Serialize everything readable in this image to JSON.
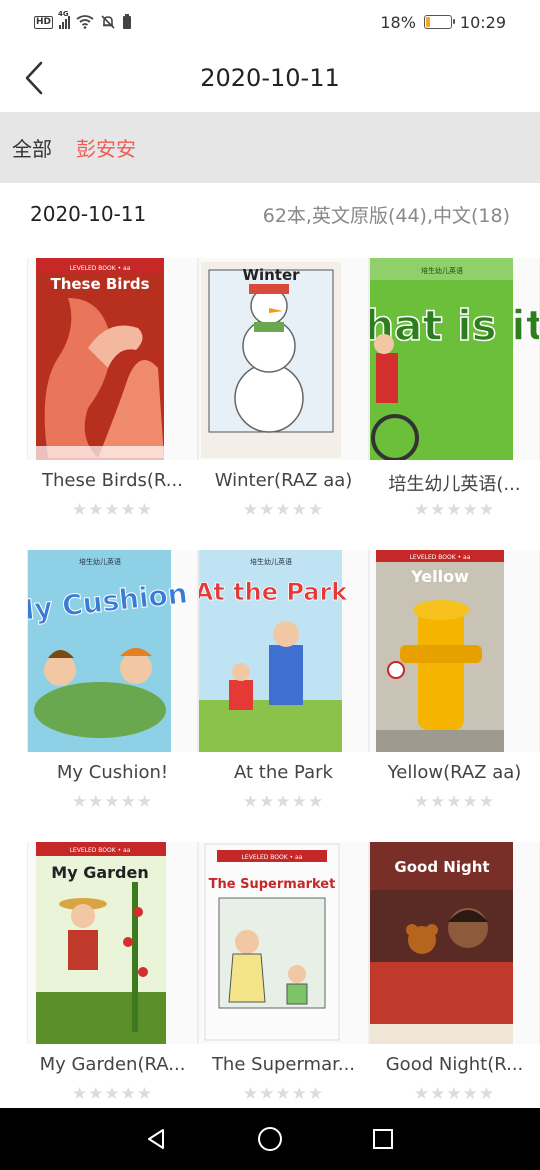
{
  "status_bar": {
    "hd_badge": "HD",
    "network": "4G",
    "battery_text": "18%",
    "battery_level": 0.18,
    "time": "10:29",
    "icons": [
      "signal-icon",
      "wifi-icon",
      "bell-muted-icon",
      "sim-icon",
      "battery-icon"
    ]
  },
  "header": {
    "title": "2020-10-11",
    "back_icon": "chevron-left-icon"
  },
  "filters": {
    "items": [
      {
        "label": "全部",
        "active": false
      },
      {
        "label": "彭安安",
        "active": true
      }
    ],
    "active_color": "#f25a52"
  },
  "summary": {
    "date": "2020-10-11",
    "stats": "62本,英文原版(44),中文(18)"
  },
  "books": [
    {
      "title": "These Birds(R...",
      "cover_label": "These Birds",
      "rating": 0
    },
    {
      "title": "Winter(RAZ aa)",
      "cover_label": "Winter",
      "rating": 0
    },
    {
      "title": "培生幼儿英语(...",
      "cover_label": "What is it?",
      "rating": 0
    },
    {
      "title": "My Cushion!",
      "cover_label": "My Cushion",
      "rating": 0
    },
    {
      "title": "At the Park",
      "cover_label": "At the Park",
      "rating": 0
    },
    {
      "title": "Yellow(RAZ aa)",
      "cover_label": "Yellow",
      "rating": 0
    },
    {
      "title": "My Garden(RA...",
      "cover_label": "My Garden",
      "rating": 0
    },
    {
      "title": "The Supermar...",
      "cover_label": "The Supermarket",
      "rating": 0
    },
    {
      "title": "Good Night(R...",
      "cover_label": "Good Night",
      "rating": 0
    }
  ],
  "stars_glyph": "★★★★★",
  "nav_bar": {
    "icons": [
      "back-triangle-icon",
      "home-circle-icon",
      "recents-square-icon"
    ]
  }
}
